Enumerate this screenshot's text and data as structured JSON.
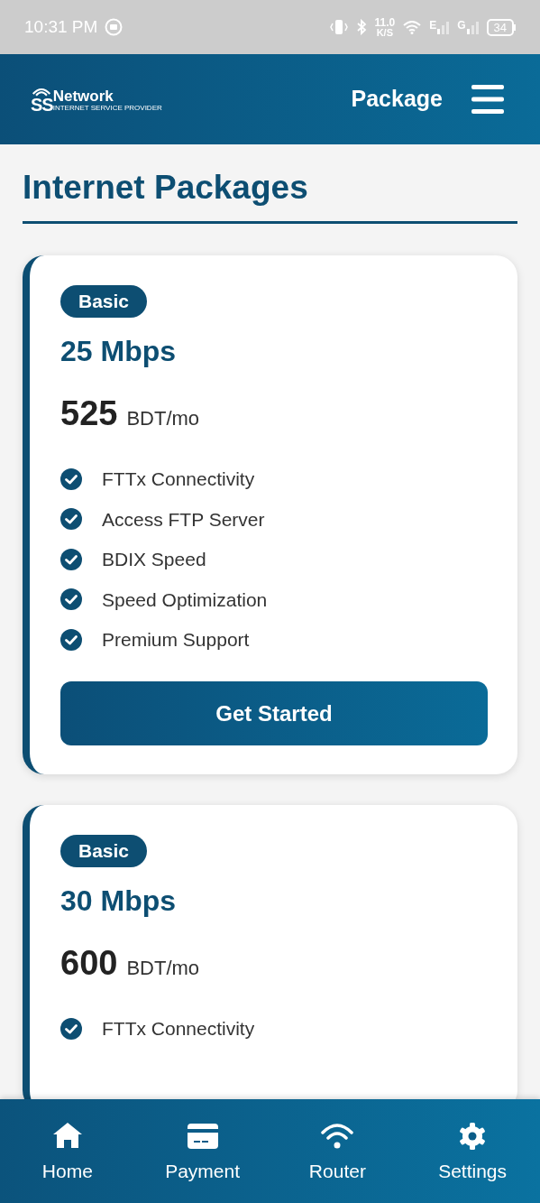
{
  "status_bar": {
    "time": "10:31 PM",
    "speed": "11.0",
    "speed_unit": "K/S",
    "signal_1": "E",
    "signal_2": "G",
    "battery": "34"
  },
  "header": {
    "logo": {
      "mark": "SS",
      "name": "Network",
      "tagline": "INTERNET SERVICE PROVIDER"
    },
    "title": "Package"
  },
  "page_title": "Internet Packages",
  "packages": [
    {
      "badge": "Basic",
      "speed": "25 Mbps",
      "price": "525",
      "unit": "BDT/mo",
      "features": [
        "FTTx Connectivity",
        "Access FTP Server",
        "BDIX Speed",
        "Speed Optimization",
        "Premium Support"
      ],
      "button": "Get Started"
    },
    {
      "badge": "Basic",
      "speed": "30 Mbps",
      "price": "600",
      "unit": "BDT/mo",
      "features": [
        "FTTx Connectivity"
      ]
    }
  ],
  "nav": [
    {
      "label": "Home",
      "kind": "home"
    },
    {
      "label": "Payment",
      "kind": "payment"
    },
    {
      "label": "Router",
      "kind": "router"
    },
    {
      "label": "Settings",
      "kind": "settings"
    }
  ]
}
